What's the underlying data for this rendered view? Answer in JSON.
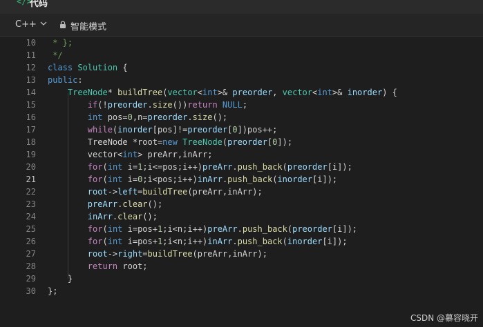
{
  "title": {
    "icon": "</>",
    "text": "代码"
  },
  "toolbar": {
    "language": "C++",
    "mode": "智能模式"
  },
  "icons": {
    "chevron": "chevron-down-icon",
    "lock": "lock-icon",
    "code": "code-icon"
  },
  "editor": {
    "active_line": "21",
    "lines": [
      {
        "n": "10",
        "tokens": [
          {
            "t": " * };",
            "c": "cm"
          }
        ]
      },
      {
        "n": "11",
        "tokens": [
          {
            "t": " */",
            "c": "cm"
          }
        ]
      },
      {
        "n": "12",
        "tokens": [
          {
            "t": "class ",
            "c": "kw"
          },
          {
            "t": "Solution",
            "c": "ty"
          },
          {
            "t": " {",
            "c": ""
          }
        ]
      },
      {
        "n": "13",
        "tokens": [
          {
            "t": "public",
            "c": "kw"
          },
          {
            "t": ":",
            "c": ""
          }
        ]
      },
      {
        "n": "14",
        "tokens": [
          {
            "t": "    ",
            "c": ""
          },
          {
            "t": "TreeNode",
            "c": "ty"
          },
          {
            "t": "* ",
            "c": ""
          },
          {
            "t": "buildTree",
            "c": "fn"
          },
          {
            "t": "(",
            "c": ""
          },
          {
            "t": "vector",
            "c": "ty"
          },
          {
            "t": "<",
            "c": ""
          },
          {
            "t": "int",
            "c": "kw"
          },
          {
            "t": ">& ",
            "c": ""
          },
          {
            "t": "preorder",
            "c": "va"
          },
          {
            "t": ", ",
            "c": ""
          },
          {
            "t": "vector",
            "c": "ty"
          },
          {
            "t": "<",
            "c": ""
          },
          {
            "t": "int",
            "c": "kw"
          },
          {
            "t": ">& ",
            "c": ""
          },
          {
            "t": "inorder",
            "c": "va"
          },
          {
            "t": ") {",
            "c": ""
          }
        ]
      },
      {
        "n": "15",
        "tokens": [
          {
            "t": "        ",
            "c": ""
          },
          {
            "t": "if",
            "c": "ctl"
          },
          {
            "t": "(!",
            "c": ""
          },
          {
            "t": "preorder",
            "c": "va"
          },
          {
            "t": ".",
            "c": ""
          },
          {
            "t": "size",
            "c": "fn"
          },
          {
            "t": "())",
            "c": ""
          },
          {
            "t": "return",
            "c": "ctl"
          },
          {
            "t": " ",
            "c": ""
          },
          {
            "t": "NULL",
            "c": "kw"
          },
          {
            "t": ";",
            "c": ""
          }
        ]
      },
      {
        "n": "16",
        "tokens": [
          {
            "t": "        ",
            "c": ""
          },
          {
            "t": "int",
            "c": "kw"
          },
          {
            "t": " pos=",
            "c": ""
          },
          {
            "t": "0",
            "c": "nu"
          },
          {
            "t": ",n=",
            "c": ""
          },
          {
            "t": "preorder",
            "c": "va"
          },
          {
            "t": ".",
            "c": ""
          },
          {
            "t": "size",
            "c": "fn"
          },
          {
            "t": "();",
            "c": ""
          }
        ]
      },
      {
        "n": "17",
        "tokens": [
          {
            "t": "        ",
            "c": ""
          },
          {
            "t": "while",
            "c": "ctl"
          },
          {
            "t": "(",
            "c": ""
          },
          {
            "t": "inorder",
            "c": "va"
          },
          {
            "t": "[pos]!=",
            "c": ""
          },
          {
            "t": "preorder",
            "c": "va"
          },
          {
            "t": "[",
            "c": ""
          },
          {
            "t": "0",
            "c": "nu"
          },
          {
            "t": "])pos++;",
            "c": ""
          }
        ]
      },
      {
        "n": "18",
        "tokens": [
          {
            "t": "        ",
            "c": ""
          },
          {
            "t": "TreeNode",
            "c": ""
          },
          {
            "t": " *root=",
            "c": ""
          },
          {
            "t": "new",
            "c": "kw"
          },
          {
            "t": " ",
            "c": ""
          },
          {
            "t": "TreeNode",
            "c": "ty"
          },
          {
            "t": "(",
            "c": ""
          },
          {
            "t": "preorder",
            "c": "va"
          },
          {
            "t": "[",
            "c": ""
          },
          {
            "t": "0",
            "c": "nu"
          },
          {
            "t": "]);",
            "c": ""
          }
        ]
      },
      {
        "n": "19",
        "tokens": [
          {
            "t": "        ",
            "c": ""
          },
          {
            "t": "vector",
            "c": ""
          },
          {
            "t": "<",
            "c": ""
          },
          {
            "t": "int",
            "c": "kw"
          },
          {
            "t": "> preArr,inArr;",
            "c": ""
          }
        ]
      },
      {
        "n": "20",
        "tokens": [
          {
            "t": "        ",
            "c": ""
          },
          {
            "t": "for",
            "c": "ctl"
          },
          {
            "t": "(",
            "c": ""
          },
          {
            "t": "int",
            "c": "kw"
          },
          {
            "t": " i=",
            "c": ""
          },
          {
            "t": "1",
            "c": "nu"
          },
          {
            "t": ";i<=pos;i++)",
            "c": ""
          },
          {
            "t": "preArr",
            "c": "va"
          },
          {
            "t": ".",
            "c": ""
          },
          {
            "t": "push_back",
            "c": "fn"
          },
          {
            "t": "(",
            "c": ""
          },
          {
            "t": "preorder",
            "c": "va"
          },
          {
            "t": "[i]);",
            "c": ""
          }
        ]
      },
      {
        "n": "21",
        "tokens": [
          {
            "t": "        ",
            "c": ""
          },
          {
            "t": "for",
            "c": "ctl"
          },
          {
            "t": "(",
            "c": ""
          },
          {
            "t": "int",
            "c": "kw"
          },
          {
            "t": " i=",
            "c": ""
          },
          {
            "t": "0",
            "c": "nu"
          },
          {
            "t": ";i<pos;i++)",
            "c": ""
          },
          {
            "t": "inArr",
            "c": "va"
          },
          {
            "t": ".",
            "c": ""
          },
          {
            "t": "push_back",
            "c": "fn"
          },
          {
            "t": "(",
            "c": ""
          },
          {
            "t": "inorder",
            "c": "va"
          },
          {
            "t": "[i]);",
            "c": ""
          }
        ]
      },
      {
        "n": "22",
        "tokens": [
          {
            "t": "        ",
            "c": ""
          },
          {
            "t": "root",
            "c": "va"
          },
          {
            "t": "->",
            "c": ""
          },
          {
            "t": "left",
            "c": "va"
          },
          {
            "t": "=",
            "c": ""
          },
          {
            "t": "buildTree",
            "c": "fn"
          },
          {
            "t": "(preArr,inArr);",
            "c": ""
          }
        ]
      },
      {
        "n": "23",
        "tokens": [
          {
            "t": "        ",
            "c": ""
          },
          {
            "t": "preArr",
            "c": "va"
          },
          {
            "t": ".",
            "c": ""
          },
          {
            "t": "clear",
            "c": "fn"
          },
          {
            "t": "();",
            "c": ""
          }
        ]
      },
      {
        "n": "24",
        "tokens": [
          {
            "t": "        ",
            "c": ""
          },
          {
            "t": "inArr",
            "c": "va"
          },
          {
            "t": ".",
            "c": ""
          },
          {
            "t": "clear",
            "c": "fn"
          },
          {
            "t": "();",
            "c": ""
          }
        ]
      },
      {
        "n": "25",
        "tokens": [
          {
            "t": "        ",
            "c": ""
          },
          {
            "t": "for",
            "c": "ctl"
          },
          {
            "t": "(",
            "c": ""
          },
          {
            "t": "int",
            "c": "kw"
          },
          {
            "t": " i=pos+",
            "c": ""
          },
          {
            "t": "1",
            "c": "nu"
          },
          {
            "t": ";i<n;i++)",
            "c": ""
          },
          {
            "t": "preArr",
            "c": "va"
          },
          {
            "t": ".",
            "c": ""
          },
          {
            "t": "push_back",
            "c": "fn"
          },
          {
            "t": "(",
            "c": ""
          },
          {
            "t": "preorder",
            "c": "va"
          },
          {
            "t": "[i]);",
            "c": ""
          }
        ]
      },
      {
        "n": "26",
        "tokens": [
          {
            "t": "        ",
            "c": ""
          },
          {
            "t": "for",
            "c": "ctl"
          },
          {
            "t": "(",
            "c": ""
          },
          {
            "t": "int",
            "c": "kw"
          },
          {
            "t": " i=pos+",
            "c": ""
          },
          {
            "t": "1",
            "c": "nu"
          },
          {
            "t": ";i<n;i++)",
            "c": ""
          },
          {
            "t": "inArr",
            "c": "va"
          },
          {
            "t": ".",
            "c": ""
          },
          {
            "t": "push_back",
            "c": "fn"
          },
          {
            "t": "(",
            "c": ""
          },
          {
            "t": "inorder",
            "c": "va"
          },
          {
            "t": "[i]);",
            "c": ""
          }
        ]
      },
      {
        "n": "27",
        "tokens": [
          {
            "t": "        ",
            "c": ""
          },
          {
            "t": "root",
            "c": "va"
          },
          {
            "t": "->",
            "c": ""
          },
          {
            "t": "right",
            "c": "va"
          },
          {
            "t": "=",
            "c": ""
          },
          {
            "t": "buildTree",
            "c": "fn"
          },
          {
            "t": "(preArr,inArr);",
            "c": ""
          }
        ]
      },
      {
        "n": "28",
        "tokens": [
          {
            "t": "        ",
            "c": ""
          },
          {
            "t": "return",
            "c": "ctl"
          },
          {
            "t": " root;",
            "c": ""
          }
        ]
      },
      {
        "n": "29",
        "tokens": [
          {
            "t": "    }",
            "c": ""
          }
        ]
      },
      {
        "n": "30",
        "tokens": [
          {
            "t": "};",
            "c": ""
          }
        ]
      }
    ]
  },
  "watermark": "CSDN @慕容晓开"
}
